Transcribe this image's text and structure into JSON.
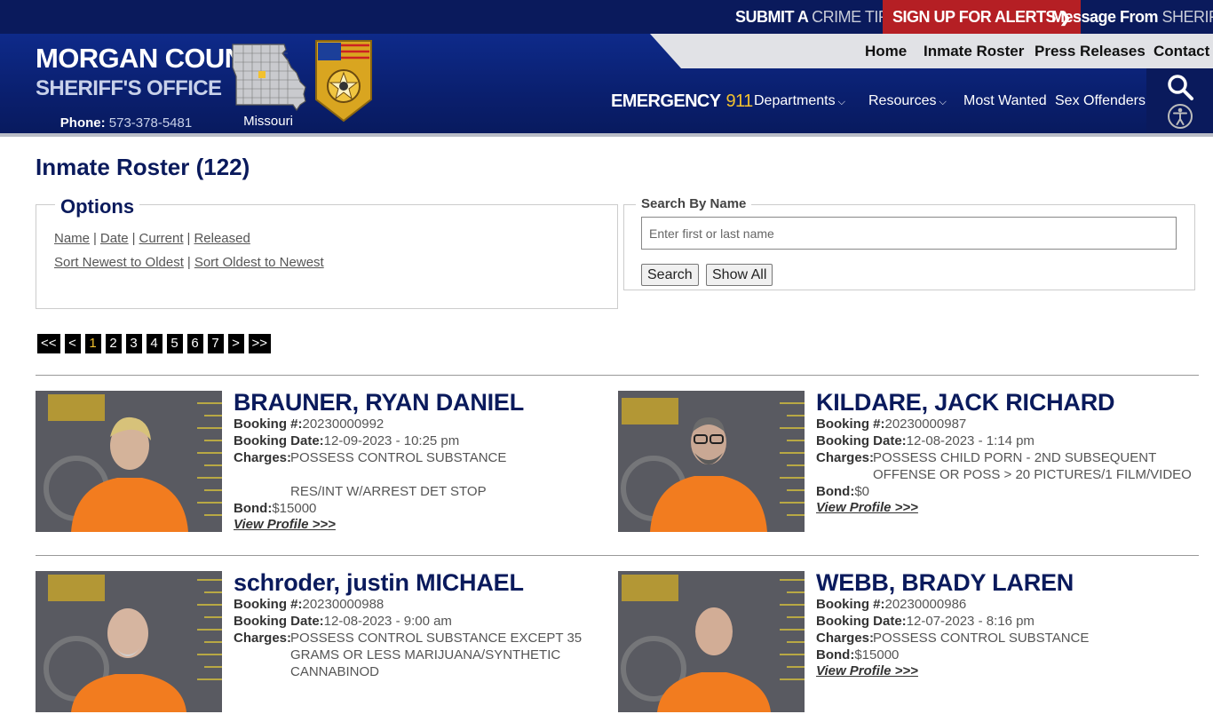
{
  "topbar": {
    "crime_tip_a": "SUBMIT A ",
    "crime_tip_b": "CRIME TIP",
    "alerts_a": "SIGN UP ",
    "alerts_b": "FOR ALERTS",
    "sheriff_a": "Message From ",
    "sheriff_b": "SHERIFF"
  },
  "brand": {
    "line1": "MORGAN COUNTY",
    "line2": "SHERIFF'S OFFICE",
    "phone_label": "Phone: ",
    "phone": "573-378-5481",
    "state": "Missouri"
  },
  "nav_top": [
    "Home",
    "Inmate Roster",
    "Press Releases",
    "Contact"
  ],
  "emergency": {
    "label": "EMERGENCY",
    "number": "911"
  },
  "nav_main": {
    "departments": "Departments",
    "resources": "Resources",
    "most_wanted": "Most Wanted",
    "sex_offenders": "Sex Offenders"
  },
  "page": {
    "title": "Inmate Roster (122)"
  },
  "options": {
    "legend": "Options",
    "sort_links": [
      "Name",
      "Date",
      "Current",
      "Released"
    ],
    "order_links": [
      "Sort Newest to Oldest",
      "Sort Oldest to Newest"
    ]
  },
  "search": {
    "legend": "Search By Name",
    "placeholder": "Enter first or last name",
    "search_button": "Search",
    "show_all_button": "Show All"
  },
  "pager": [
    "<<",
    "<",
    "1",
    "2",
    "3",
    "4",
    "5",
    "6",
    "7",
    ">",
    ">>"
  ],
  "labels": {
    "booking_no": "Booking #:",
    "booking_date": "Booking Date:",
    "charges": "Charges:",
    "bond": "Bond:",
    "view_profile": "View Profile >>>"
  },
  "inmates": [
    {
      "name": "BRAUNER, RYAN DANIEL",
      "booking_no": "20230000992",
      "booking_date": "12-09-2023 - 10:25 pm",
      "charges": "POSSESS CONTROL SUBSTANCE\n\nRES/INT W/ARREST DET STOP",
      "bond": "$15000"
    },
    {
      "name": "KILDARE, JACK RICHARD",
      "booking_no": "20230000987",
      "booking_date": "12-08-2023 - 1:14 pm",
      "charges": "POSSESS CHILD PORN - 2ND SUBSEQUENT\nOFFENSE OR POSS > 20 PICTURES/1 FILM/VIDEO",
      "bond": "$0"
    },
    {
      "name": "schroder, justin MICHAEL",
      "booking_no": "20230000988",
      "booking_date": "12-08-2023 - 9:00 am",
      "charges": "POSSESS CONTROL SUBSTANCE EXCEPT 35\nGRAMS OR LESS MARIJUANA/SYNTHETIC\nCANNABINOD",
      "bond": ""
    },
    {
      "name": "WEBB, BRADY LAREN",
      "booking_no": "20230000986",
      "booking_date": "12-07-2023 - 8:16 pm",
      "charges": "POSSESS CONTROL SUBSTANCE",
      "bond": "$15000"
    }
  ]
}
